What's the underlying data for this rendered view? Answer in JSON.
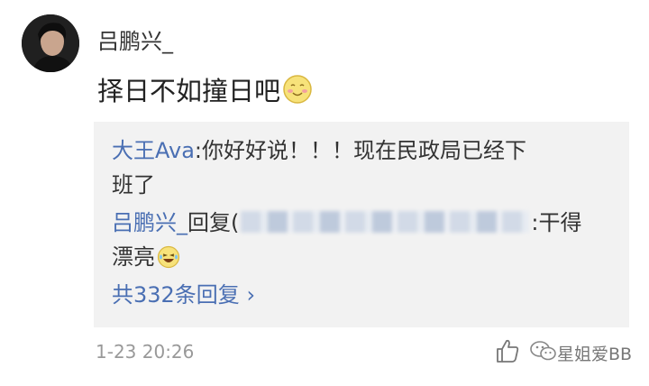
{
  "comment": {
    "author": "吕鹏兴_",
    "avatar_icon": "user-avatar",
    "text": "择日不如撞日吧",
    "emoji_icon": "smile-emoji-icon"
  },
  "replies": [
    {
      "author": "大王Ava",
      "separator": ":",
      "text_line1": "你好好说！！！现在民政局已经下",
      "text_line2": "班了"
    },
    {
      "author": "吕鹏兴_",
      "reply_word": "回复",
      "open_paren": "(",
      "after_blur": ":干得",
      "text_line2": "漂亮",
      "emoji_icon": "laugh-emoji-icon"
    }
  ],
  "more_replies": "共332条回复",
  "more_chevron": "›",
  "timestamp": "1-23 20:26",
  "footer": {
    "like_icon": "thumbs-up-icon",
    "wechat_icon": "wechat-icon",
    "watermark": "星姐爱BB"
  },
  "colors": {
    "link": "#4a6fb3",
    "reply_bg": "#f2f2f2",
    "meta": "#999999"
  }
}
